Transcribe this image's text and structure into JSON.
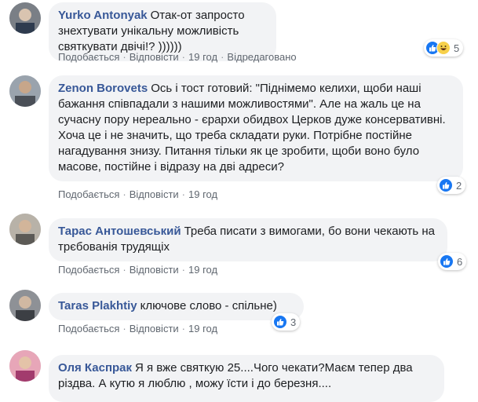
{
  "comments": [
    {
      "author": "Yurko Antonyak",
      "text": "Отак-от запросто знехтувати унікальну можливість святкувати двічі!? ))))))",
      "like_label": "Подобається",
      "reply_label": "Відповісти",
      "time": "19 год",
      "edited_label": "Відредаговано",
      "reaction_count": "5",
      "reactions": [
        "like-icon",
        "haha-icon"
      ]
    },
    {
      "author": "Zenon Borovets",
      "text": "Ось і тост готовий: \"Піднімемо келихи, щоби наші бажання співпадали з нашими можливостями\". Але на жаль це на сучасну пору нереально - єрархи обидвох Церков дуже консервативні. Хоча це і не значить, що треба складати руки. Потрібне постійне нагадування знизу. Питання тільки як це зробити, щоби воно було масове, постійне і відразу на дві адреси?",
      "like_label": "Подобається",
      "reply_label": "Відповісти",
      "time": "19 год",
      "reaction_count": "2",
      "reactions": [
        "like-icon"
      ]
    },
    {
      "author": "Тарас Антошевський",
      "text": "Треба писати з вимогами, бо вони чекають на трєбованія трудящіх",
      "like_label": "Подобається",
      "reply_label": "Відповісти",
      "time": "19 год",
      "reaction_count": "6",
      "reactions": [
        "like-icon"
      ]
    },
    {
      "author": "Taras Plakhtiy",
      "text": "ключове слово - спільне)",
      "like_label": "Подобається",
      "reply_label": "Відповісти",
      "time": "19 год",
      "reaction_count": "3",
      "reactions": [
        "like-icon"
      ]
    },
    {
      "author": "Оля Каспрак",
      "text": "Я я вже святкую 25....Чого чекати?Маєм тепер два різдва. А кутю я люблю , можу їсти і до березня....",
      "like_label": "",
      "reply_label": "",
      "time": ""
    }
  ],
  "colors": {
    "author": "#385898",
    "bubble": "#f2f3f5",
    "like": "#1877f2",
    "haha": "#f7d04a"
  }
}
